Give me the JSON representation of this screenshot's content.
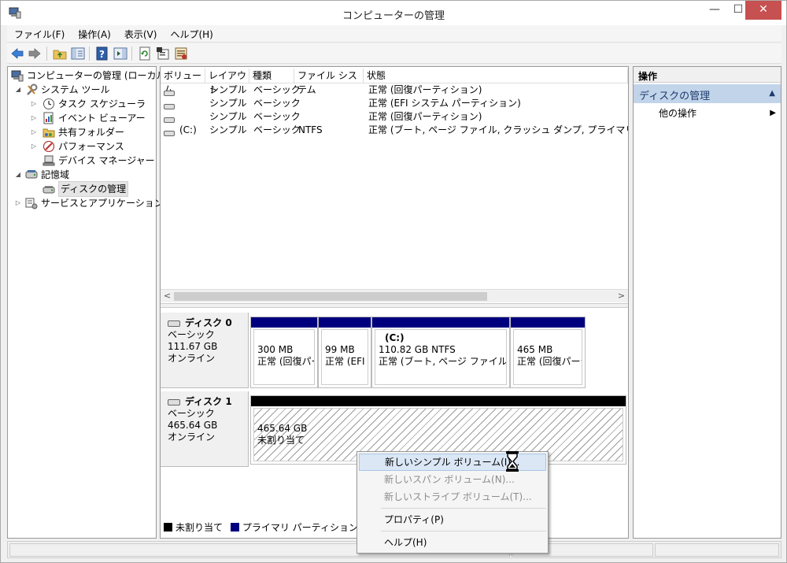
{
  "window": {
    "title": "コンピューターの管理",
    "min_glyph": "—",
    "max_glyph": "☐",
    "close_glyph": "✕"
  },
  "menu": [
    "ファイル(F)",
    "操作(A)",
    "表示(V)",
    "ヘルプ(H)"
  ],
  "toolbar_icons": [
    "back-arrow-icon",
    "forward-arrow-icon",
    "up-folder-icon",
    "show-hide-tree-icon",
    "help-icon",
    "show-hide-action-pane-icon",
    "refresh-icon",
    "properties-icon",
    "export-icon"
  ],
  "tree": {
    "root": "コンピューターの管理 (ローカル)",
    "system_tools": "システム ツール",
    "task_scheduler": "タスク スケジューラ",
    "event_viewer": "イベント ビューアー",
    "shared_folders": "共有フォルダー",
    "performance": "パフォーマンス",
    "device_manager": "デバイス マネージャー",
    "storage": "記憶域",
    "disk_management": "ディスクの管理",
    "services_apps": "サービスとアプリケーション"
  },
  "volume_table": {
    "columns": [
      "ボリューム",
      "レイアウト",
      "種類",
      "ファイル システム",
      "状態"
    ],
    "rows": [
      [
        "",
        "シンプル",
        "ベーシック",
        "",
        "正常 (回復パーティション)"
      ],
      [
        "",
        "シンプル",
        "ベーシック",
        "",
        "正常 (EFI システム パーティション)"
      ],
      [
        "",
        "シンプル",
        "ベーシック",
        "",
        "正常 (回復パーティション)"
      ],
      [
        "(C:)",
        "シンプル",
        "ベーシック",
        "NTFS",
        "正常 (ブート, ページ ファイル, クラッシュ ダンプ, プライマリ パーティション)"
      ]
    ],
    "scroll_left": "<",
    "scroll_right": ">"
  },
  "disks": [
    {
      "name": "ディスク 0",
      "type": "ベーシック",
      "size": "111.67 GB",
      "status": "オンライン",
      "partitions": [
        {
          "title": "",
          "size": "300 MB",
          "state": "正常 (回復パーティ"
        },
        {
          "title": "",
          "size": "99 MB",
          "state": "正常 (EFI"
        },
        {
          "title": "(C:)",
          "size": "110.82 GB NTFS",
          "state": "正常 (ブート, ページ ファイル, クラ"
        },
        {
          "title": "",
          "size": "465 MB",
          "state": "正常 (回復パーテ"
        }
      ]
    },
    {
      "name": "ディスク 1",
      "type": "ベーシック",
      "size": "465.64 GB",
      "status": "オンライン",
      "partitions": [
        {
          "size": "465.64 GB",
          "state": "未割り当て"
        }
      ]
    }
  ],
  "legend": {
    "unallocated": "未割り当て",
    "primary": "プライマリ パーティション"
  },
  "colors": {
    "unallocated": "#000000",
    "primary": "#00007f",
    "selection": "#c2d4ea"
  },
  "actions": {
    "header": "操作",
    "selected": "ディスクの管理",
    "other": "他の操作",
    "collapse_glyph": "▲",
    "submenu_glyph": "▶"
  },
  "context_menu": {
    "new_simple": "新しいシンプル ボリューム(I)...",
    "new_spanned": "新しいスパン ボリューム(N)...",
    "new_striped": "新しいストライプ ボリューム(T)...",
    "properties": "プロパティ(P)",
    "help": "ヘルプ(H)"
  }
}
